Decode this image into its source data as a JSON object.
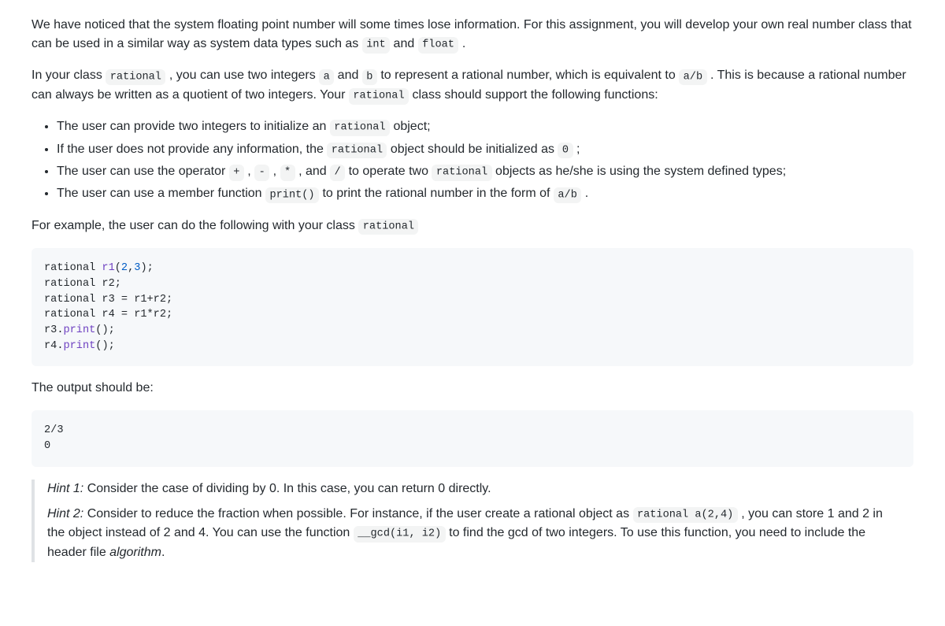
{
  "intro": {
    "p1_a": "We have noticed that the system floating point number will some times lose information. For this assignment, you will develop your own real number class that can be used in a similar way as system data types such as ",
    "int": "int",
    "p1_b": " and ",
    "float": "float",
    "p1_c": " ."
  },
  "para2": {
    "a": "In your class ",
    "rational": "rational",
    "b": " , you can use two integers ",
    "var_a": "a",
    "c": " and ",
    "var_b": "b",
    "d": " to represent a rational number, which is equivalent to ",
    "ab": "a/b",
    "e": " . This is because a rational number can always be written as a quotient of two integers. Your ",
    "f": " class should support the following functions:"
  },
  "bullets": {
    "b1_a": "The user can provide two integers to initialize an ",
    "b1_b": " object;",
    "b2_a": "If the user does not provide any information, the ",
    "b2_b": " object should be initialized as ",
    "zero": "0",
    "b2_c": " ;",
    "b3_a": "The user can use the operator ",
    "plus": "+",
    "b3_b": " , ",
    "minus": "-",
    "b3_c": " , ",
    "star": "*",
    "b3_d": " , and ",
    "slash": "/",
    "b3_e": " to operate two ",
    "b3_f": " objects as he/she is using the system defined types;",
    "b4_a": "The user can use a member function ",
    "print": "print()",
    "b4_b": " to print the rational number in the form of ",
    "b4_c": " ."
  },
  "example_lead": {
    "a": "For example, the user can do the following with your class ",
    "rational": "rational"
  },
  "code1": {
    "l1a": "rational ",
    "l1b": "r1",
    "l1c": "(",
    "l1d": "2",
    "l1e": ",",
    "l1f": "3",
    "l1g": ");",
    "l2": "rational r2;",
    "l3": "rational r3 = r1+r2;",
    "l4": "rational r4 = r1*r2;",
    "l5a": "r3.",
    "l5b": "print",
    "l5c": "();",
    "l6a": "r4.",
    "l6b": "print",
    "l6c": "();"
  },
  "output_lead": "The output should be:",
  "code2": "2/3\n0",
  "hint1": {
    "label": "Hint 1:",
    "text": " Consider the case of dividing by 0. In this case, you can return 0 directly."
  },
  "hint2": {
    "label": "Hint 2:",
    "a": " Consider to reduce the fraction when possible. For instance, if the user create a rational object as ",
    "ex": "rational a(2,4)",
    "b": " , you can store 1 and 2 in the object instead of 2 and 4. You can use the function ",
    "gcd": "__gcd(i1, i2)",
    "c": " to find the gcd of two integers. To use this function, you need to include the header file ",
    "alg": "algorithm",
    "d": "."
  }
}
